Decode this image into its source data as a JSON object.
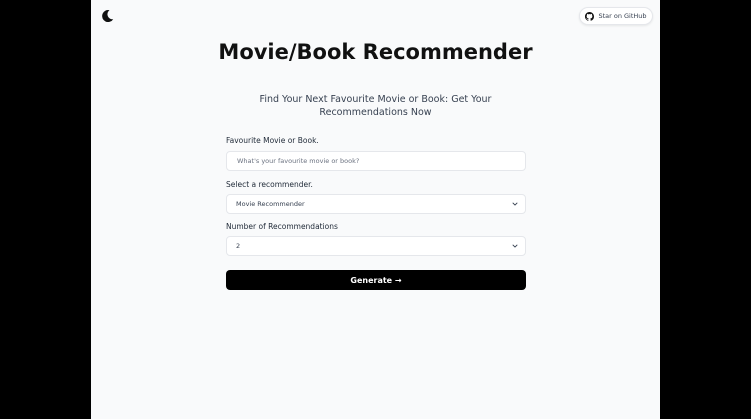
{
  "header": {
    "logo_icon": "moon-icon",
    "github_button_label": "Star on GitHub",
    "github_icon": "github-icon"
  },
  "hero": {
    "title": "Movie/Book Recommender",
    "subtitle": "Find Your Next Favourite Movie or Book: Get Your Recommendations Now"
  },
  "form": {
    "favourite_label": "Favourite Movie or Book.",
    "favourite_value": "",
    "favourite_placeholder": "What's your favourite movie or book?",
    "recommender_label": "Select a recommender.",
    "recommender_value": "Movie Recommender",
    "count_label": "Number of Recommendations",
    "count_value": "2",
    "generate_label": "Generate →"
  },
  "colors": {
    "background": "#f9fafb",
    "outer": "#000000",
    "button": "#000000",
    "button_text": "#ffffff",
    "border": "#e5e7eb"
  }
}
